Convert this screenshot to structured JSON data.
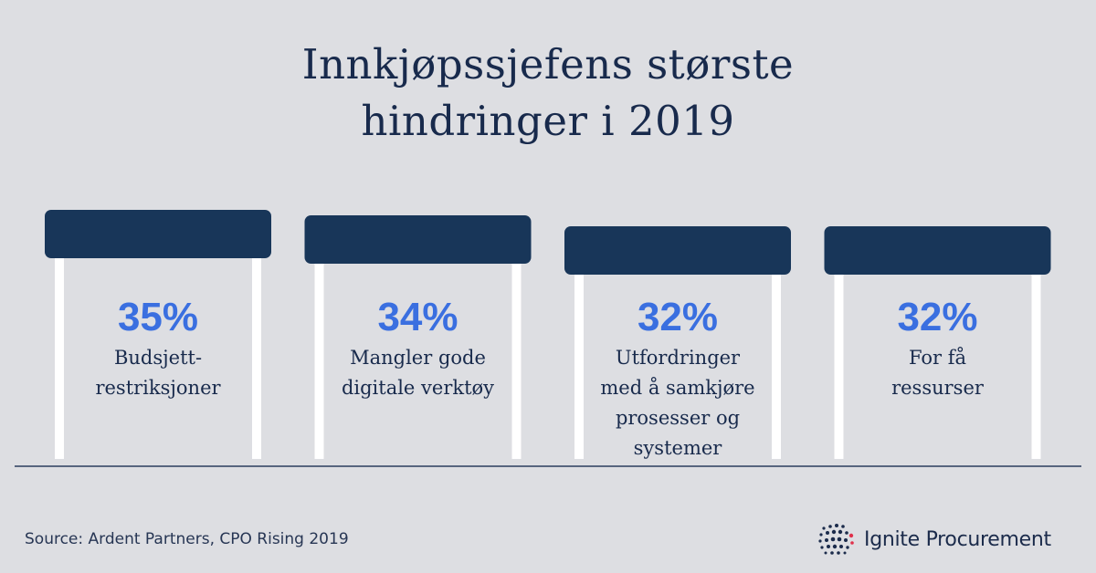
{
  "title": {
    "line1": "Innkjøpssjefens største",
    "line2": "hindringer i 2019"
  },
  "chart_data": {
    "type": "bar",
    "title": "Innkjøpssjefens største hindringer i 2019",
    "categories": [
      [
        "Budsjett-",
        "restriksjoner"
      ],
      [
        "Mangler gode",
        "digitale verktøy"
      ],
      [
        "Utfordringer",
        "med å samkjøre",
        "prosesser og",
        "systemer"
      ],
      [
        "For få",
        "ressurser"
      ]
    ],
    "values": [
      35,
      34,
      32,
      32
    ],
    "value_labels": [
      "35%",
      "34%",
      "32%",
      "32%"
    ],
    "unit": "%",
    "colors": {
      "bar_top": "#183659",
      "legs": "#ffffff",
      "value": "#3a6fe0",
      "label": "#182a4c",
      "baseline": "#2b3d5c"
    }
  },
  "footer": {
    "source": "Source: Ardent Partners, CPO Rising 2019",
    "logo_text": "Ignite Procurement",
    "logo_icon": "dot-cluster-icon"
  }
}
